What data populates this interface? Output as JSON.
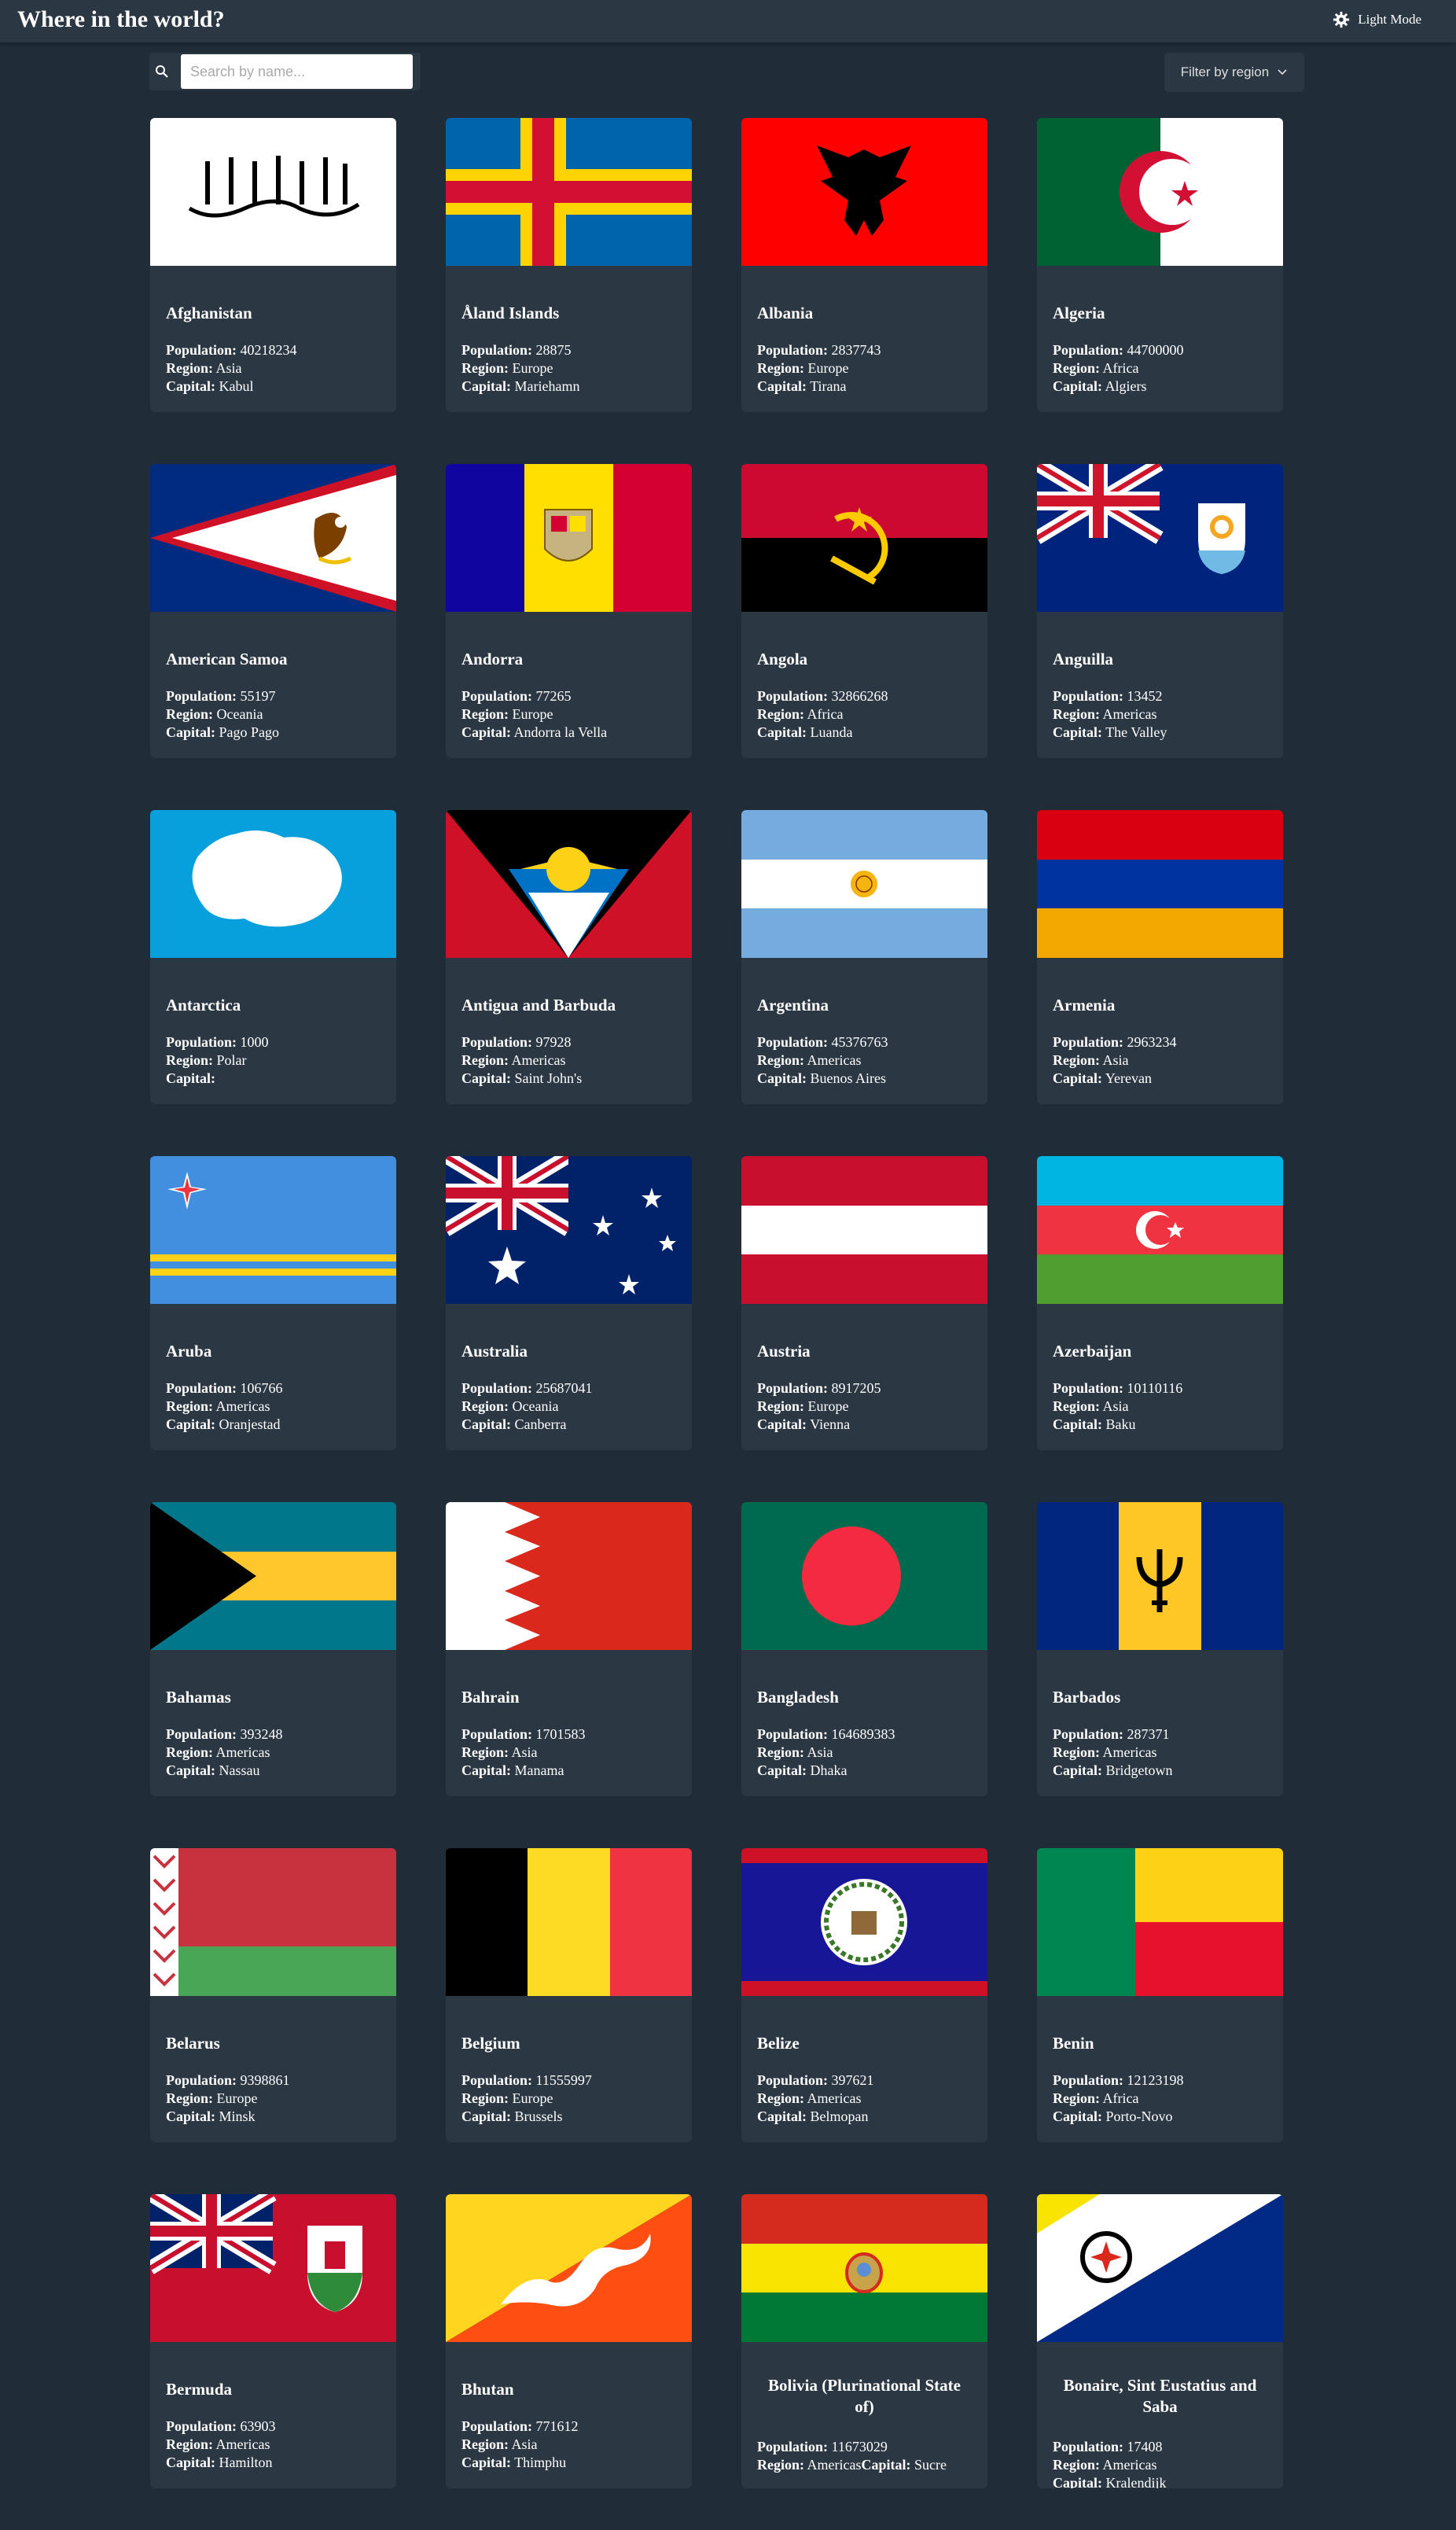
{
  "header": {
    "title": "Where in the world?",
    "mode_label": "Light Mode"
  },
  "search": {
    "placeholder": "Search by name..."
  },
  "filter": {
    "label": "Filter by region"
  },
  "labels": {
    "population": "Population:",
    "region": "Region:",
    "capital": "Capital:"
  },
  "countries": [
    {
      "name": "Afghanistan",
      "population": "40218234",
      "region": "Asia",
      "capital": "Kabul"
    },
    {
      "name": "Åland Islands",
      "population": "28875",
      "region": "Europe",
      "capital": "Mariehamn"
    },
    {
      "name": "Albania",
      "population": "2837743",
      "region": "Europe",
      "capital": "Tirana"
    },
    {
      "name": "Algeria",
      "population": "44700000",
      "region": "Africa",
      "capital": "Algiers"
    },
    {
      "name": "American Samoa",
      "population": "55197",
      "region": "Oceania",
      "capital": "Pago Pago"
    },
    {
      "name": "Andorra",
      "population": "77265",
      "region": "Europe",
      "capital": "Andorra la Vella"
    },
    {
      "name": "Angola",
      "population": "32866268",
      "region": "Africa",
      "capital": "Luanda"
    },
    {
      "name": "Anguilla",
      "population": "13452",
      "region": "Americas",
      "capital": "The Valley"
    },
    {
      "name": "Antarctica",
      "population": "1000",
      "region": "Polar",
      "capital": ""
    },
    {
      "name": "Antigua and Barbuda",
      "population": "97928",
      "region": "Americas",
      "capital": "Saint John's"
    },
    {
      "name": "Argentina",
      "population": "45376763",
      "region": "Americas",
      "capital": "Buenos Aires"
    },
    {
      "name": "Armenia",
      "population": "2963234",
      "region": "Asia",
      "capital": "Yerevan"
    },
    {
      "name": "Aruba",
      "population": "106766",
      "region": "Americas",
      "capital": "Oranjestad"
    },
    {
      "name": "Australia",
      "population": "25687041",
      "region": "Oceania",
      "capital": "Canberra"
    },
    {
      "name": "Austria",
      "population": "8917205",
      "region": "Europe",
      "capital": "Vienna"
    },
    {
      "name": "Azerbaijan",
      "population": "10110116",
      "region": "Asia",
      "capital": "Baku"
    },
    {
      "name": "Bahamas",
      "population": "393248",
      "region": "Americas",
      "capital": "Nassau"
    },
    {
      "name": "Bahrain",
      "population": "1701583",
      "region": "Asia",
      "capital": "Manama"
    },
    {
      "name": "Bangladesh",
      "population": "164689383",
      "region": "Asia",
      "capital": "Dhaka"
    },
    {
      "name": "Barbados",
      "population": "287371",
      "region": "Americas",
      "capital": "Bridgetown"
    },
    {
      "name": "Belarus",
      "population": "9398861",
      "region": "Europe",
      "capital": "Minsk"
    },
    {
      "name": "Belgium",
      "population": "11555997",
      "region": "Europe",
      "capital": "Brussels"
    },
    {
      "name": "Belize",
      "population": "397621",
      "region": "Americas",
      "capital": "Belmopan"
    },
    {
      "name": "Benin",
      "population": "12123198",
      "region": "Africa",
      "capital": "Porto-Novo"
    },
    {
      "name": "Bermuda",
      "population": "63903",
      "region": "Americas",
      "capital": "Hamilton"
    },
    {
      "name": "Bhutan",
      "population": "771612",
      "region": "Asia",
      "capital": "Thimphu"
    },
    {
      "name": "Bolivia (Plurinational State of)",
      "population": "11673029",
      "region": "Americas",
      "capital": "Sucre"
    },
    {
      "name": "Bonaire, Sint Eustatius and Saba",
      "population": "17408",
      "region": "Americas",
      "capital": "Kralendijk"
    }
  ]
}
